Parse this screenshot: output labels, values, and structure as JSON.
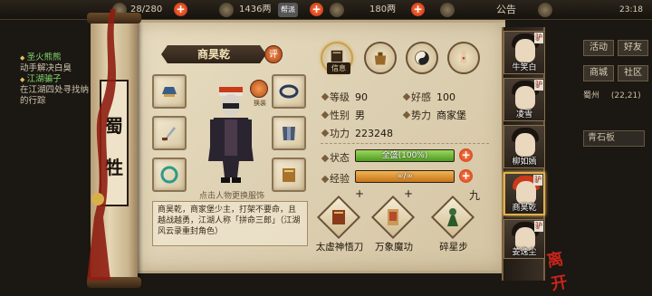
{
  "topbar": {
    "resource1": "28/280",
    "resource2": "1436两",
    "resource3": "180两",
    "announcement": "公告",
    "clock": "23:18",
    "center_badge": "帮派"
  },
  "quests": [
    {
      "title": "圣火熊熊",
      "desc": "动手解决白臭"
    },
    {
      "title": "江湖骗子",
      "desc": "在江湖四处寻找纳的行踪"
    }
  ],
  "sect_label": "蜀牲",
  "character": {
    "name": "商昊乾",
    "comment_label": "评",
    "swap_label": "换装",
    "tap_hint": "点击人物更换服饰",
    "bio": "商昊乾，商家堡少主，打架不要命，且越战越勇，江湖人称「拼命三郎」（江湖风云录重封角色）"
  },
  "tabs": [
    {
      "name": "信息",
      "icon": "info-book-icon",
      "active": true
    },
    {
      "name": "行囊",
      "icon": "bag-icon",
      "active": false
    },
    {
      "name": "太极",
      "icon": "taiji-icon",
      "active": false
    },
    {
      "name": "经脉",
      "icon": "meridian-icon",
      "active": false
    }
  ],
  "stats": {
    "level_label": "等级",
    "level": "90",
    "favor_label": "好感",
    "favor": "100",
    "gender_label": "性别",
    "gender": "男",
    "faction_label": "势力",
    "faction": "商家堡",
    "power_label": "功力",
    "power": "223248"
  },
  "status": {
    "label": "状态",
    "text": "全盛(100%)",
    "fraction": 1.0
  },
  "exp": {
    "label": "经验",
    "text": "∞/∞",
    "fraction": 1.0
  },
  "skills": [
    {
      "name": "太虚神悟刀",
      "level": "+"
    },
    {
      "name": "万象魔功",
      "level": "+"
    },
    {
      "name": "碎星步",
      "level": "九"
    }
  ],
  "party": [
    {
      "name": "牛笑白",
      "flag": "驴"
    },
    {
      "name": "凌雪",
      "flag": "驴"
    },
    {
      "name": "柳如嫣",
      "flag": ""
    },
    {
      "name": "商昊乾",
      "flag": "驴"
    },
    {
      "name": "姜逸尘",
      "flag": "驴"
    }
  ],
  "rightside": {
    "btn1": "活动",
    "btn2": "好友",
    "btn3": "商城",
    "btn4": "社区",
    "map_name": "蜀州",
    "coords": "(22,21)",
    "region": "青石板"
  },
  "close_seal": "离开",
  "colors": {
    "accent": "#c8241a",
    "bar_green": "#6cbf3a",
    "bar_orange": "#e09030",
    "parchment": "#e3d6b8"
  }
}
